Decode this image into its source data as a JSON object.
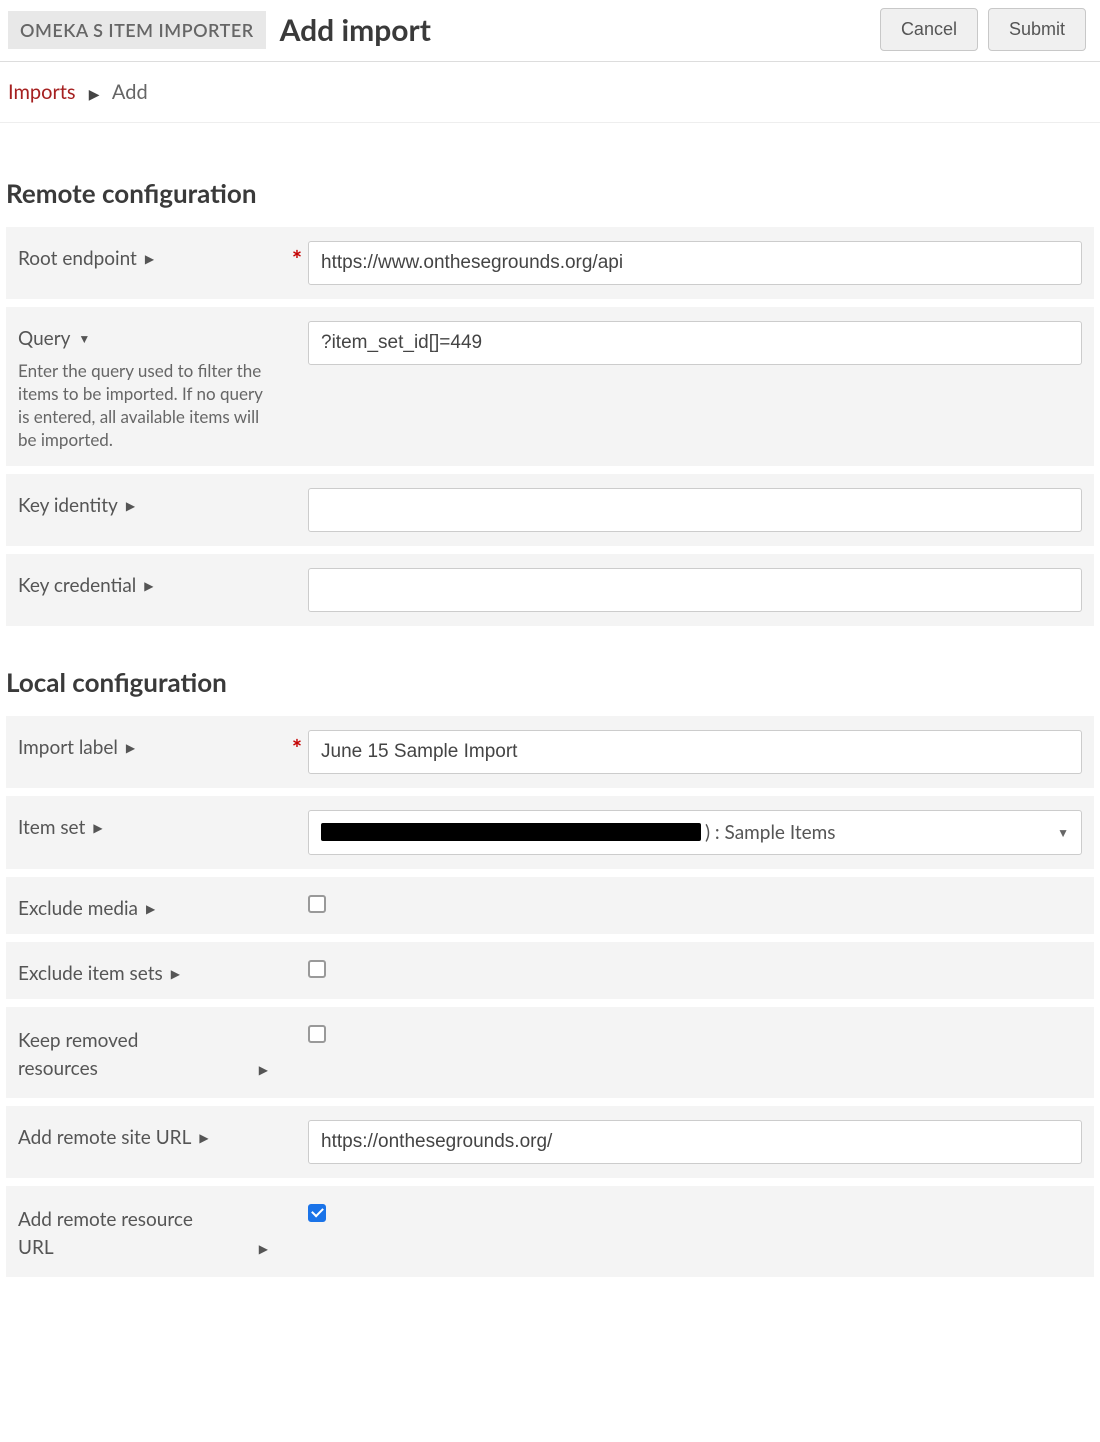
{
  "header": {
    "module_badge": "OMEKA S ITEM IMPORTER",
    "page_title": "Add import",
    "cancel_label": "Cancel",
    "submit_label": "Submit"
  },
  "breadcrumb": {
    "link_label": "Imports",
    "current_label": "Add"
  },
  "sections": {
    "remote": {
      "title": "Remote configuration",
      "root_endpoint": {
        "label": "Root endpoint",
        "value": "https://www.onthesegrounds.org/api",
        "required": true
      },
      "query": {
        "label": "Query",
        "value": "?item_set_id[]=449",
        "help": "Enter the query used to filter the items to be imported. If no query is entered, all available items will be imported."
      },
      "key_identity": {
        "label": "Key identity",
        "value": ""
      },
      "key_credential": {
        "label": "Key credential",
        "value": ""
      }
    },
    "local": {
      "title": "Local configuration",
      "import_label": {
        "label": "Import label",
        "value": "June 15 Sample Import",
        "required": true
      },
      "item_set": {
        "label": "Item set",
        "selected_suffix": ") : Sample Items"
      },
      "exclude_media": {
        "label": "Exclude media",
        "checked": false
      },
      "exclude_item_sets": {
        "label": "Exclude item sets",
        "checked": false
      },
      "keep_removed": {
        "label_line1": "Keep removed",
        "label_line2": "resources",
        "checked": false
      },
      "add_remote_site_url": {
        "label": "Add remote site URL",
        "value": "https://onthesegrounds.org/"
      },
      "add_remote_resource_url": {
        "label_line1": "Add remote resource",
        "label_line2": "URL",
        "checked": true
      }
    }
  }
}
